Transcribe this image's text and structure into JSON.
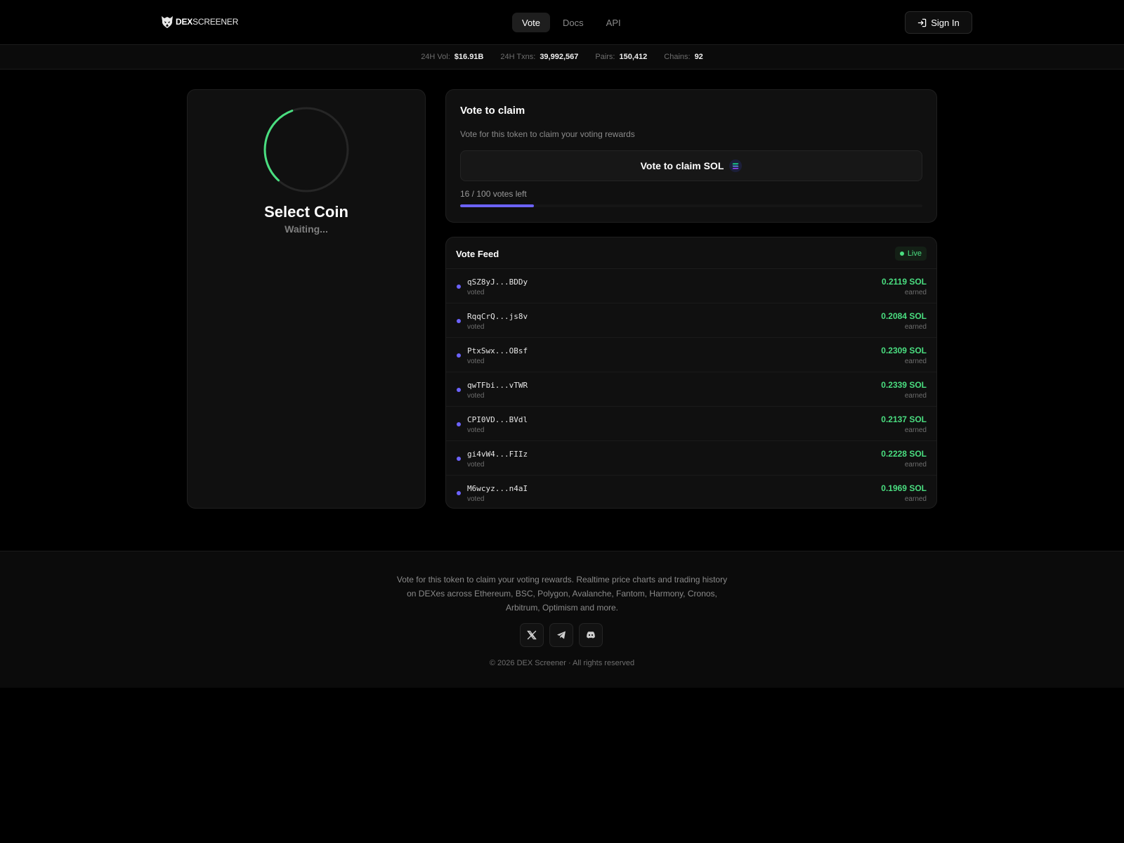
{
  "header": {
    "logo_bold": "DEX",
    "logo_light": "SCREENER",
    "nav": [
      {
        "label": "Vote",
        "active": true
      },
      {
        "label": "Docs",
        "active": false
      },
      {
        "label": "API",
        "active": false
      }
    ],
    "signin_label": "Sign In"
  },
  "stats": [
    {
      "key": "24H Vol:",
      "value": "$16.91B"
    },
    {
      "key": "24H Txns:",
      "value": "39,992,567"
    },
    {
      "key": "Pairs:",
      "value": "150,412"
    },
    {
      "key": "Chains:",
      "value": "92"
    }
  ],
  "coin_panel": {
    "title": "Select Coin",
    "status": "Waiting...",
    "spinner_color": "#4ade80"
  },
  "vote": {
    "title": "Vote to claim",
    "description": "Vote for this token to claim your voting rewards",
    "button_label": "Vote to claim SOL",
    "votes_left_text": "16 / 100 votes left",
    "progress_fraction": 0.16,
    "accent_color": "#6c63ff"
  },
  "feed": {
    "title": "Vote Feed",
    "live_label": "Live",
    "rows": [
      {
        "address": "qSZ8yJ...BDDy",
        "action": "voted",
        "amount": "0.2119 SOL",
        "earned": "earned"
      },
      {
        "address": "RqqCrQ...js8v",
        "action": "voted",
        "amount": "0.2084 SOL",
        "earned": "earned"
      },
      {
        "address": "PtxSwx...OBsf",
        "action": "voted",
        "amount": "0.2309 SOL",
        "earned": "earned"
      },
      {
        "address": "qwTFbi...vTWR",
        "action": "voted",
        "amount": "0.2339 SOL",
        "earned": "earned"
      },
      {
        "address": "CPI0VD...BVdl",
        "action": "voted",
        "amount": "0.2137 SOL",
        "earned": "earned"
      },
      {
        "address": "gi4vW4...FIIz",
        "action": "voted",
        "amount": "0.2228 SOL",
        "earned": "earned"
      },
      {
        "address": "M6wcyz...n4aI",
        "action": "voted",
        "amount": "0.1969 SOL",
        "earned": "earned"
      }
    ]
  },
  "footer": {
    "text": "Vote for this token to claim your voting rewards. Realtime price charts and trading history on DEXes across Ethereum, BSC, Polygon, Avalanche, Fantom, Harmony, Cronos, Arbitrum, Optimism and more.",
    "socials": [
      "x-icon",
      "telegram-icon",
      "discord-icon"
    ],
    "copyright": "© 2026 DEX Screener · All rights reserved"
  }
}
